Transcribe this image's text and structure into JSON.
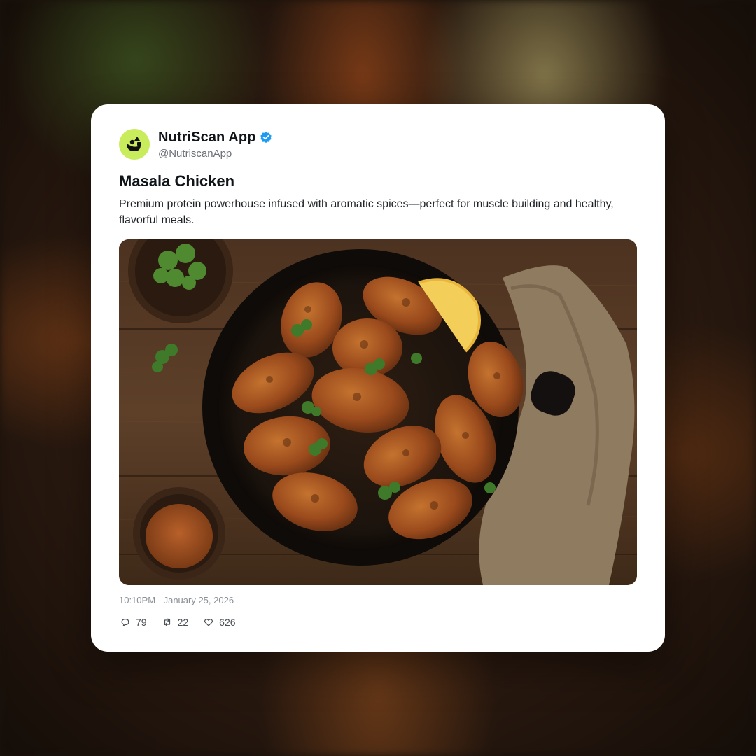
{
  "account": {
    "display_name": "NutriScan App",
    "handle": "@NutriscanApp",
    "verified": true,
    "avatar_color": "#c8ec5c",
    "verified_color": "#1d9bf0"
  },
  "post": {
    "title": "Masala Chicken",
    "description": "Premium protein powerhouse infused with aromatic spices—perfect for muscle building and healthy, flavorful meals.",
    "timestamp": "10:10PM - January 25, 2026",
    "image_icon": "masala-chicken-photo"
  },
  "stats": {
    "replies": "79",
    "reposts": "22",
    "likes": "626",
    "icons": [
      "comment-icon",
      "repost-icon",
      "heart-icon"
    ]
  }
}
